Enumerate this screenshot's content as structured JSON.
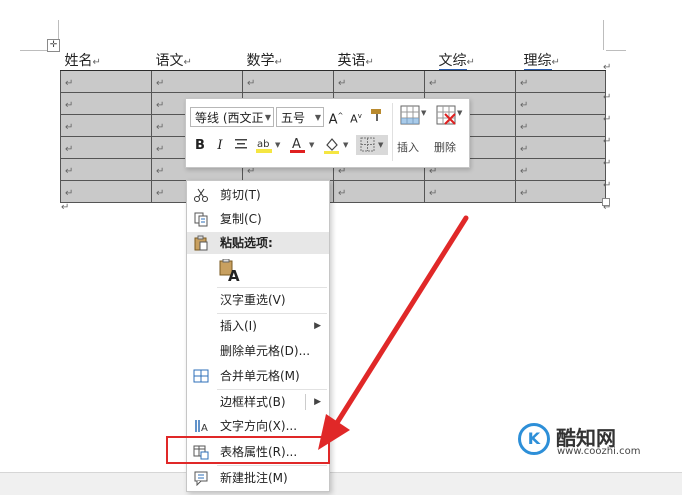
{
  "table": {
    "handle_icon": "table-move-icon",
    "headers": [
      "姓名",
      "语文",
      "数学",
      "英语",
      "文综",
      "理综"
    ],
    "cell_mark": "↵",
    "body_rows": 6,
    "after_mark": "↵"
  },
  "mini_toolbar": {
    "font_name": "等线 (西文正",
    "font_size": "五号",
    "grow_font": "A",
    "shrink_font": "A",
    "bold": "B",
    "italic": "I",
    "font_color_glyph": "A",
    "insert_label": "插入",
    "delete_label": "删除",
    "highlight_color": "#f5e642",
    "font_color": "#e02020"
  },
  "context_menu": {
    "cut": "剪切(T)",
    "copy": "复制(C)",
    "paste_options": "粘贴选项:",
    "paste_glyph": "A",
    "reconvert": "汉字重选(V)",
    "insert": "插入(I)",
    "delete_cells": "删除单元格(D)...",
    "merge_cells": "合并单元格(M)",
    "border_styles": "边框样式(B)",
    "text_direction": "文字方向(X)...",
    "table_properties": "表格属性(R)...",
    "new_comment": "新建批注(M)"
  },
  "highlight": {
    "color": "#e02828"
  },
  "watermark": {
    "logo": "K",
    "name": "酷知网",
    "url": "www.coozhi.com"
  }
}
